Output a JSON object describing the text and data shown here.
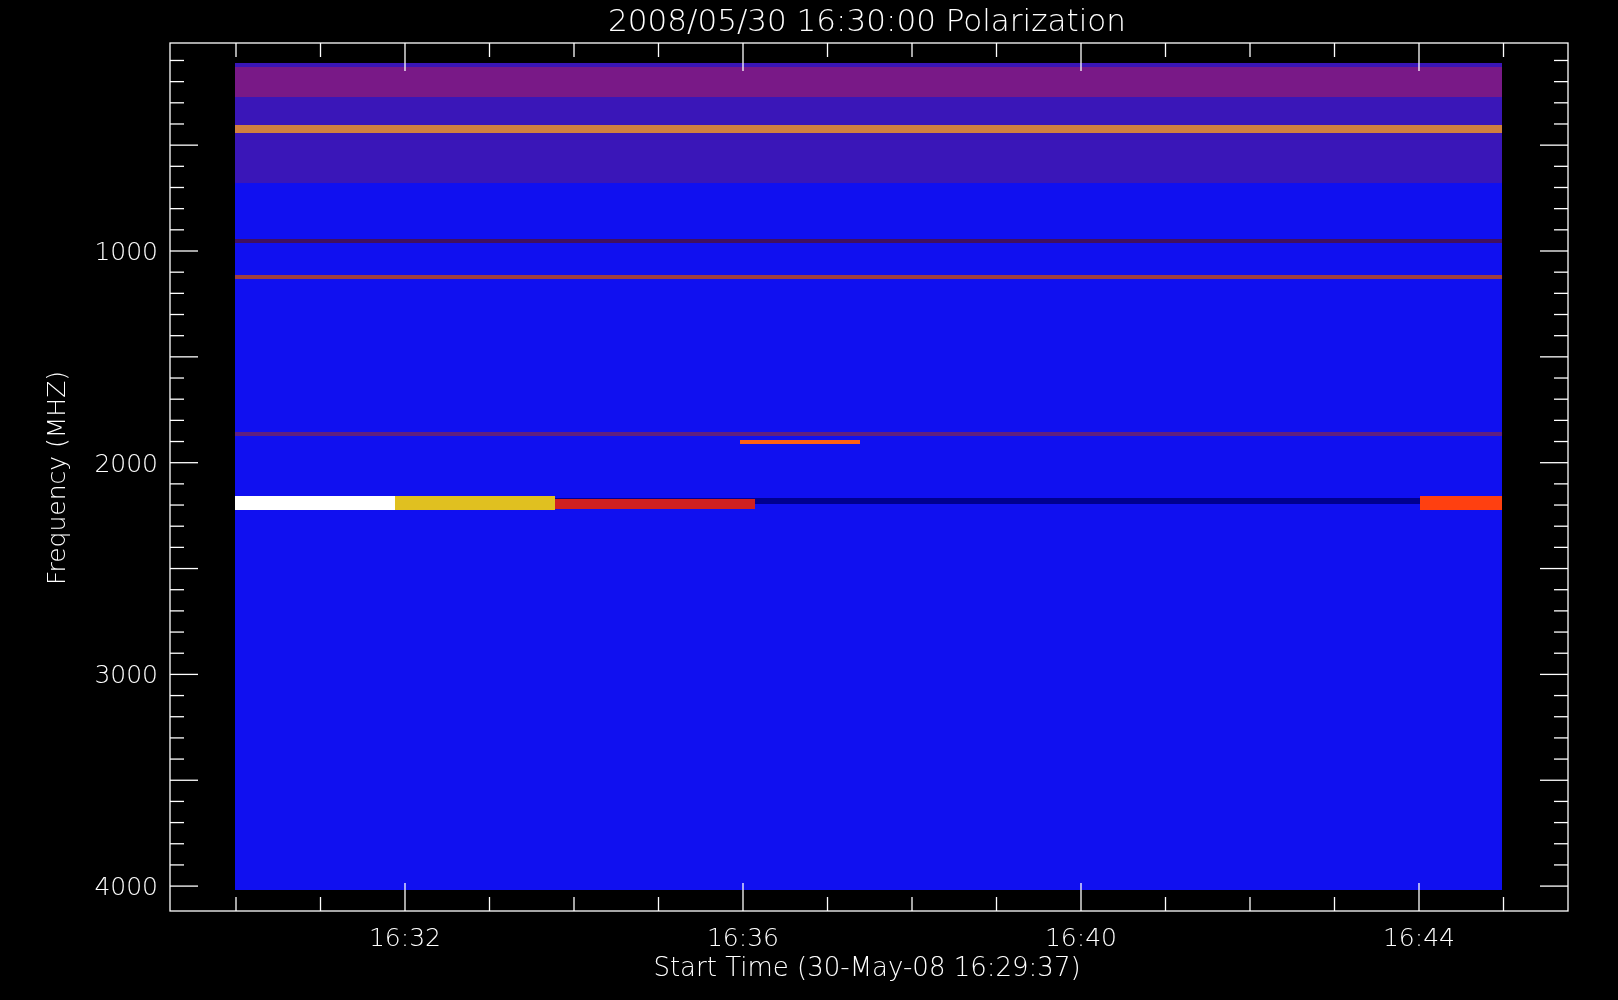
{
  "title": "2008/05/30 16:30:00 Polarization",
  "y_axis": {
    "label": "Frequency (MHZ)",
    "ticks": [
      "1000",
      "2000",
      "3000",
      "4000"
    ]
  },
  "x_axis": {
    "label": "Start Time (30-May-08 16:29:37)",
    "ticks": [
      "16:32",
      "16:36",
      "16:40",
      "16:44"
    ]
  }
}
